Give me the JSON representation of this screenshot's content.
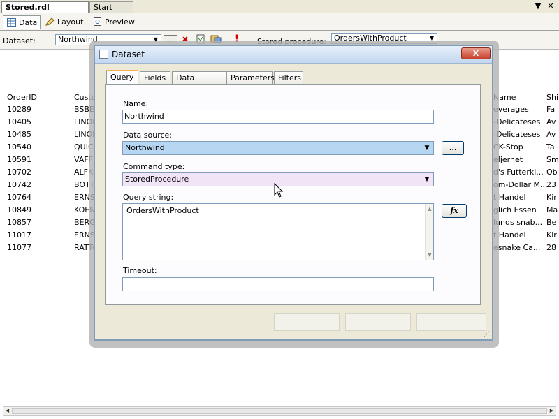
{
  "doc_tabs": {
    "active": "Stored.rdl [Design]*",
    "inactive": "Start Page",
    "dropdown_glyph": "▼",
    "close_glyph": "✕"
  },
  "view_tabs": [
    {
      "label": "Data",
      "icon": "data-grid-icon"
    },
    {
      "label": "Layout",
      "icon": "layout-icon"
    },
    {
      "label": "Preview",
      "icon": "preview-icon"
    }
  ],
  "toolbar": {
    "dataset_label": "Dataset:",
    "dataset_value": "Northwind",
    "ellipsis": "...",
    "sp_label": "Stored procedure:",
    "sp_value": "OrdersWithProduct",
    "exclamation": "!"
  },
  "grid": {
    "headers": [
      "OrderID",
      "Custo"
    ],
    "right_headers": [
      "Name",
      "Shi"
    ],
    "rows": [
      [
        "10289",
        "BSBEV",
        "everages",
        "Fa"
      ],
      [
        "10405",
        "LINOD",
        "-Delicateses",
        "Av"
      ],
      [
        "10485",
        "LINOD",
        "-Delicateses",
        "Av"
      ],
      [
        "10540",
        "QUICK",
        "CK-Stop",
        "Ta"
      ],
      [
        "10591",
        "VAFFE",
        "eljernet",
        "Sm"
      ],
      [
        "10702",
        "ALFKI",
        "d's Futterki...",
        "Ob"
      ],
      [
        "10742",
        "BOTTM",
        "om-Dollar M...",
        "23"
      ],
      [
        "10764",
        "ERNSH",
        "t Handel",
        "Kir"
      ],
      [
        "10849",
        "KOENE",
        "glich Essen",
        "Ma"
      ],
      [
        "10857",
        "BERGS",
        "lunds snab...",
        "Be"
      ],
      [
        "11017",
        "ERNSH",
        "t Handel",
        "Kir"
      ],
      [
        "11077",
        "RATTC",
        "esnake Ca...",
        "28"
      ]
    ]
  },
  "dialog": {
    "title": "Dataset",
    "close": "X",
    "tabs": [
      "Query",
      "Fields",
      "Data Options",
      "Parameters",
      "Filters"
    ],
    "name_label": "Name:",
    "name_value": "Northwind",
    "datasource_label": "Data source:",
    "datasource_value": "Northwind",
    "datasource_btn": "...",
    "cmdtype_label": "Command type:",
    "cmdtype_value": "StoredProcedure",
    "query_label": "Query string:",
    "query_value": "OrdersWithProduct",
    "fx_btn": "fx",
    "timeout_label": "Timeout:",
    "timeout_value": ""
  }
}
